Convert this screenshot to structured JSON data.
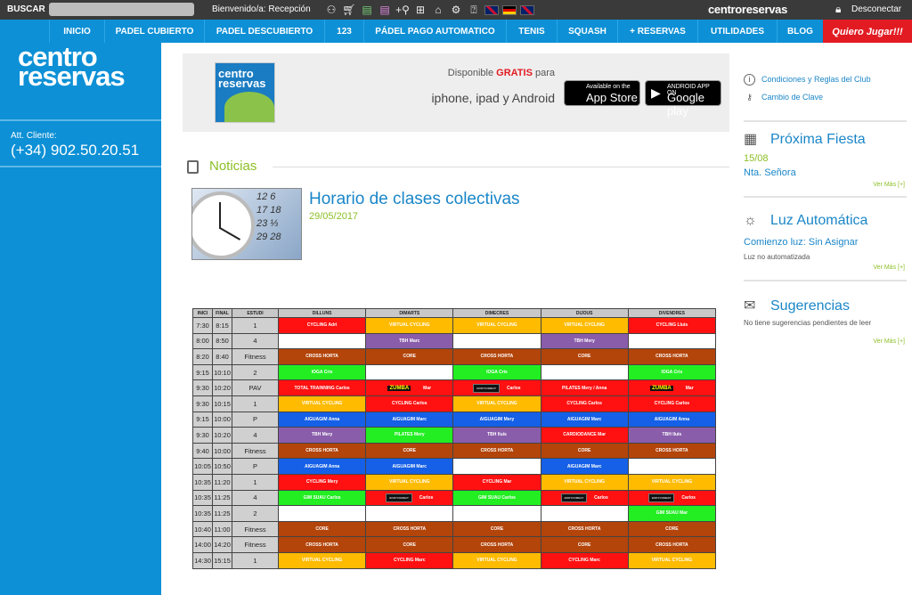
{
  "topbar": {
    "search_label": "BUSCAR",
    "welcome": "Bienvenido/a: Recepción",
    "brand": "centroreservas",
    "logout": "Desconectar"
  },
  "nav": {
    "items": [
      "INICIO",
      "PADEL CUBIERTO",
      "PADEL DESCUBIERTO",
      "123",
      "PÁDEL PAGO AUTOMATICO",
      "TENIS",
      "SQUASH",
      "+ RESERVAS",
      "UTILIDADES",
      "BLOG"
    ],
    "cta": "Quiero Jugar!!!"
  },
  "sidebar": {
    "logo_line1": "centro",
    "logo_line2": "reservas",
    "att_label": "Att. Cliente:",
    "phone": "(+34) 902.50.20.51"
  },
  "banner": {
    "logo_line1": "centro",
    "logo_line2": "reservas",
    "disponible_pre": "Disponible ",
    "gratis": "GRATIS",
    "disponible_post": " para",
    "platforms": "iphone, ipad y Android",
    "appstore_small": "Available on the",
    "appstore_big": "App Store",
    "googleplay_small": "ANDROID APP ON",
    "googleplay_big": "Google play"
  },
  "news": {
    "section_title": "Noticias",
    "title": "Horario de clases colectivas",
    "date": "29/05/2017",
    "thumb_numbers": "12 ' 6\n17 18\n23 ⅓\n29 28"
  },
  "schedule": {
    "headers": [
      "INICI",
      "FINAL",
      "ESTUDI",
      "DILLUNS",
      "DIMARTS",
      "DIMECRES",
      "DIJOUS",
      "DIVENDRES"
    ],
    "rows": [
      {
        "start": "7:30",
        "end": "8:15",
        "room": "1",
        "cells": [
          [
            "r",
            "CYCLING Adri"
          ],
          [
            "o",
            "VIRTUAL CYCLING"
          ],
          [
            "o",
            "VIRTUAL CYCLING"
          ],
          [
            "o",
            "VIRTUAL CYCLING"
          ],
          [
            "r",
            "CYCLING Lluis"
          ]
        ]
      },
      {
        "start": "8:00",
        "end": "8:50",
        "room": "4",
        "cells": [
          [
            "w",
            ""
          ],
          [
            "p",
            "TBH Marc"
          ],
          [
            "w",
            ""
          ],
          [
            "p",
            "TBH Mery"
          ],
          [
            "w",
            ""
          ]
        ]
      },
      {
        "start": "8:20",
        "end": "8:40",
        "room": "Fitness",
        "cells": [
          [
            "b",
            "CROSS HORTA"
          ],
          [
            "b",
            "CORE"
          ],
          [
            "b",
            "CROSS HORTA"
          ],
          [
            "b",
            "CORE"
          ],
          [
            "b",
            "CROSS HORTA"
          ]
        ]
      },
      {
        "start": "9:15",
        "end": "10:10",
        "room": "2",
        "cells": [
          [
            "g",
            "IOGA Cris"
          ],
          [
            "w",
            ""
          ],
          [
            "g",
            "IOGA Cris"
          ],
          [
            "w",
            ""
          ],
          [
            "g",
            "IOGA Cris"
          ]
        ]
      },
      {
        "start": "9:30",
        "end": "10:20",
        "room": "PAV",
        "cells": [
          [
            "r",
            "TOTAL TRAINNING Carlos"
          ],
          [
            "rz",
            "Mar"
          ],
          [
            "rc",
            "Carlos"
          ],
          [
            "r",
            "PILATES Mery / Anna"
          ],
          [
            "rz",
            "Mar"
          ]
        ]
      },
      {
        "start": "9:30",
        "end": "10:15",
        "room": "1",
        "cells": [
          [
            "o",
            "VIRTUAL CYCLING"
          ],
          [
            "r",
            "CYCLING Carlos"
          ],
          [
            "o",
            "VIRTUAL CYCLING"
          ],
          [
            "r",
            "CYCLING Carlos"
          ],
          [
            "r",
            "CYCLING Carlos"
          ]
        ]
      },
      {
        "start": "9:15",
        "end": "10:00",
        "room": "P",
        "cells": [
          [
            "u",
            "AIGUAGIM Anna"
          ],
          [
            "u",
            "AIGUAGIM Marc"
          ],
          [
            "u",
            "AIGUAGIM Mery"
          ],
          [
            "u",
            "AIGUAGIM Marc"
          ],
          [
            "u",
            "AIGUAGIM Anna"
          ]
        ]
      },
      {
        "start": "9:30",
        "end": "10:20",
        "room": "4",
        "cells": [
          [
            "p",
            "TBH Mery"
          ],
          [
            "g",
            "PILATES Mery"
          ],
          [
            "p",
            "TBH lluís"
          ],
          [
            "r",
            "CARDIODANCE Mar"
          ],
          [
            "p",
            "TBH lluís"
          ]
        ]
      },
      {
        "start": "9:40",
        "end": "10:00",
        "room": "Fitness",
        "cells": [
          [
            "b",
            "CROSS HORTA"
          ],
          [
            "b",
            "CORE"
          ],
          [
            "b",
            "CROSS HORTA"
          ],
          [
            "b",
            "CORE"
          ],
          [
            "b",
            "CROSS HORTA"
          ]
        ]
      },
      {
        "start": "10:05",
        "end": "10:50",
        "room": "P",
        "cells": [
          [
            "u",
            "AIGUAGIM Anna"
          ],
          [
            "u",
            "AIGUAGIM Marc"
          ],
          [
            "w",
            ""
          ],
          [
            "u",
            "AIGUAGIM Marc"
          ],
          [
            "w",
            ""
          ]
        ]
      },
      {
        "start": "10:35",
        "end": "11:20",
        "room": "1",
        "cells": [
          [
            "r",
            "CYCLING Mery"
          ],
          [
            "o",
            "VIRTUAL CYCLING"
          ],
          [
            "r",
            "CYCLING Mar"
          ],
          [
            "o",
            "VIRTUAL CYCLING"
          ],
          [
            "o",
            "VIRTUAL CYCLING"
          ]
        ]
      },
      {
        "start": "10:35",
        "end": "11:25",
        "room": "4",
        "cells": [
          [
            "g",
            "GIM SUAU Carlos"
          ],
          [
            "rc",
            "Carlos"
          ],
          [
            "g",
            "GIM SUAU Carlos"
          ],
          [
            "rc",
            "Carlos"
          ],
          [
            "rc",
            "Carlos"
          ]
        ]
      },
      {
        "start": "10:35",
        "end": "11:25",
        "room": "2",
        "cells": [
          [
            "w",
            ""
          ],
          [
            "w",
            ""
          ],
          [
            "w",
            ""
          ],
          [
            "w",
            ""
          ],
          [
            "g",
            "GIM SUAU Mar"
          ]
        ]
      },
      {
        "start": "10:40",
        "end": "11:00",
        "room": "Fitness",
        "cells": [
          [
            "b",
            "CORE"
          ],
          [
            "b",
            "CROSS HORTA"
          ],
          [
            "b",
            "CORE"
          ],
          [
            "b",
            "CROSS HORTA"
          ],
          [
            "b",
            "CORE"
          ]
        ]
      },
      {
        "start": "14:00",
        "end": "14:20",
        "room": "Fitness",
        "cells": [
          [
            "b",
            "CROSS HORTA"
          ],
          [
            "b",
            "CORE"
          ],
          [
            "b",
            "CROSS HORTA"
          ],
          [
            "b",
            "CORE"
          ],
          [
            "b",
            "CROSS HORTA"
          ]
        ]
      },
      {
        "start": "14:30",
        "end": "15:15",
        "room": "1",
        "cells": [
          [
            "o",
            "VIRTUAL CYCLING"
          ],
          [
            "r",
            "CYCLING Marc"
          ],
          [
            "o",
            "VIRTUAL CYCLING"
          ],
          [
            "r",
            "CYCLING Marc"
          ],
          [
            "o",
            "VIRTUAL CYCLING"
          ]
        ]
      }
    ],
    "colors": {
      "r": "#ff1111",
      "o": "#ffbb00",
      "p": "#8a5dab",
      "b": "#b3440a",
      "g": "#22ee22",
      "u": "#1560e6",
      "w": "#ffffff"
    }
  },
  "right": {
    "link1": "Condiciones y Reglas del Club",
    "link2": "Cambio de Clave",
    "fiesta_title": "Próxima Fiesta",
    "fiesta_date": "15/08",
    "fiesta_name": "Nta. Señora",
    "luz_title": "Luz Automática",
    "luz_status": "Comienzo luz: Sin Asignar",
    "luz_note": "Luz no automatizada",
    "sug_title": "Sugerencias",
    "sug_text": "No tiene sugerencias pendientes de leer",
    "ver_mas": "Ver Más [+]"
  }
}
